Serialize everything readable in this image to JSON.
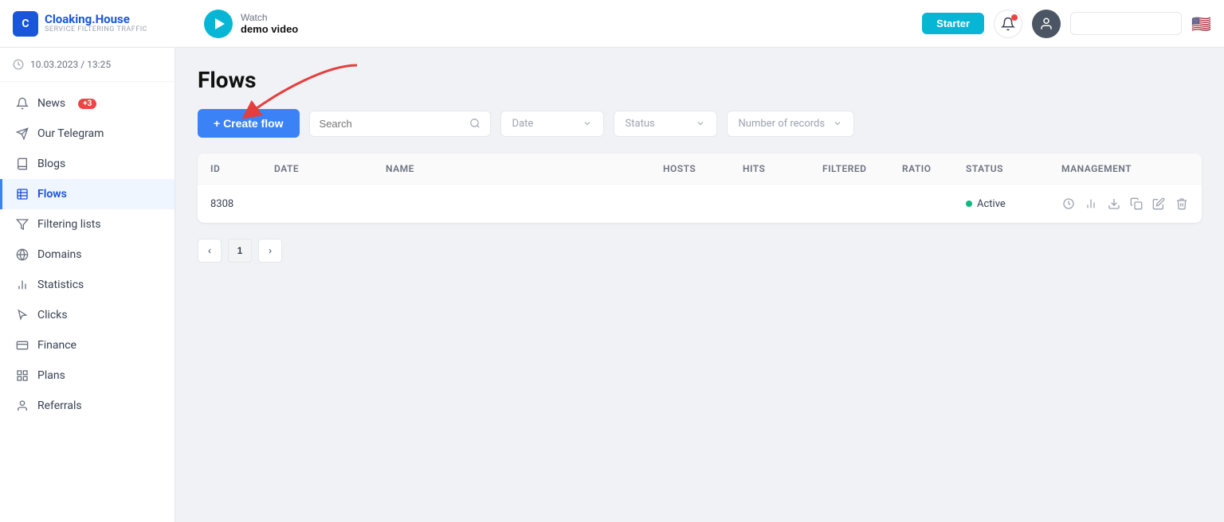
{
  "header": {
    "logo_brand": "Cloaking.",
    "logo_brand_accent": "House",
    "logo_sub": "Service Filtering Traffic",
    "demo_watch": "Watch",
    "demo_label": "demo video",
    "starter_label": "Starter",
    "search_placeholder": ""
  },
  "sidebar": {
    "datetime": "10.03.2023 / 13:25",
    "items": [
      {
        "id": "news",
        "label": "News",
        "badge": "+3",
        "icon": "bell"
      },
      {
        "id": "telegram",
        "label": "Our Telegram",
        "badge": null,
        "icon": "send"
      },
      {
        "id": "blogs",
        "label": "Blogs",
        "badge": null,
        "icon": "book"
      },
      {
        "id": "flows",
        "label": "Flows",
        "badge": null,
        "icon": "flow",
        "active": true
      },
      {
        "id": "filtering",
        "label": "Filtering lists",
        "badge": null,
        "icon": "filter"
      },
      {
        "id": "domains",
        "label": "Domains",
        "badge": null,
        "icon": "globe"
      },
      {
        "id": "statistics",
        "label": "Statistics",
        "badge": null,
        "icon": "bar-chart"
      },
      {
        "id": "clicks",
        "label": "Clicks",
        "badge": null,
        "icon": "cursor"
      },
      {
        "id": "finance",
        "label": "Finance",
        "badge": null,
        "icon": "wallet"
      },
      {
        "id": "plans",
        "label": "Plans",
        "badge": null,
        "icon": "plan"
      },
      {
        "id": "referrals",
        "label": "Referrals",
        "badge": null,
        "icon": "referral"
      }
    ]
  },
  "main": {
    "title": "Flows",
    "create_flow_label": "+ Create flow",
    "search_placeholder": "Search",
    "date_placeholder": "Date",
    "status_placeholder": "Status",
    "records_placeholder": "Number of records",
    "table": {
      "headers": [
        "ID",
        "Date",
        "Name",
        "Hosts",
        "Hits",
        "Filtered",
        "Ratio",
        "Status",
        "Management"
      ],
      "rows": [
        {
          "id": "8308",
          "date": "",
          "name": "",
          "hosts": "",
          "hits": "",
          "filtered": "",
          "ratio": "",
          "status": "Active",
          "status_active": true
        }
      ]
    },
    "pagination": {
      "current": 1,
      "prev_label": "‹",
      "next_label": "›"
    }
  }
}
